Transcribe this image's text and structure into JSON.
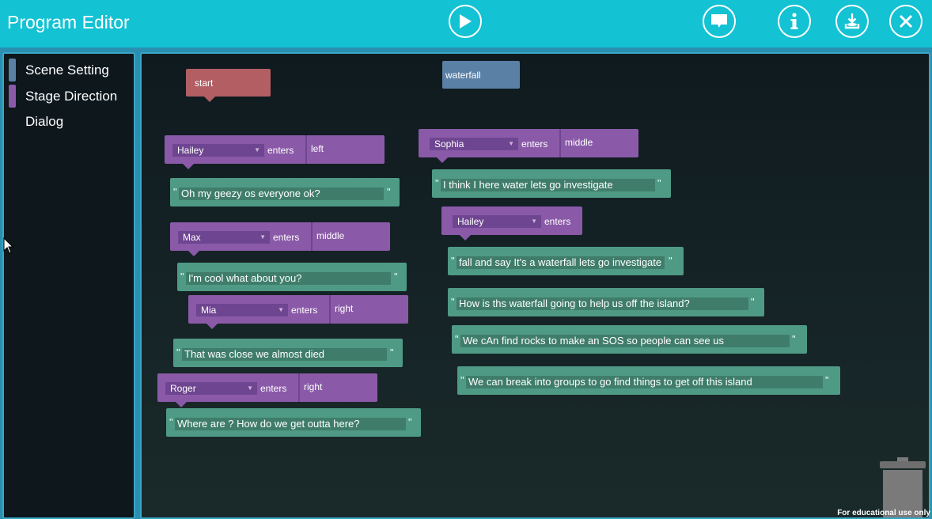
{
  "app": {
    "title": "Program Editor"
  },
  "toolbar": {
    "play": "play-icon",
    "chat": "chat-icon",
    "info": "info-icon",
    "save": "save-icon",
    "close": "close-icon"
  },
  "sidebar": {
    "categories": [
      {
        "label": "Scene Setting",
        "color": "#5b80a6"
      },
      {
        "label": "Stage Direction",
        "color": "#8a5aa8"
      },
      {
        "label": "Dialog",
        "color": ""
      }
    ]
  },
  "blocks": {
    "start": {
      "label": "start"
    },
    "waterfall": {
      "label": "waterfall"
    },
    "enters_word": "enters",
    "stage": [
      {
        "character": "Hailey",
        "position": "left"
      },
      {
        "character": "Max",
        "position": "middle"
      },
      {
        "character": "Mia",
        "position": "right"
      },
      {
        "character": "Roger",
        "position": "right"
      },
      {
        "character": "Sophia",
        "position": "middle"
      },
      {
        "character": "Hailey",
        "position": ""
      }
    ],
    "dialogs": [
      "Oh my geezy os everyone ok?",
      "I'm cool what about you?",
      "That was close we almost died",
      "Where are ? How do we get outta here?",
      "I think I here water lets go investigate",
      "fall and say It's a waterfall lets go investigate",
      "How is ths waterfall going to help us off the island?",
      "We cAn find rocks to make an SOS so people can see us",
      "We can break into groups to go find things to get off this island"
    ],
    "quote_char": "\""
  },
  "footer": {
    "text": "For educational use only"
  },
  "colors": {
    "topbar": "#13c2d3",
    "start": "#b25e63",
    "scene": "#5b80a6",
    "stage": "#8a5aa8",
    "dialog": "#4f9a85"
  }
}
